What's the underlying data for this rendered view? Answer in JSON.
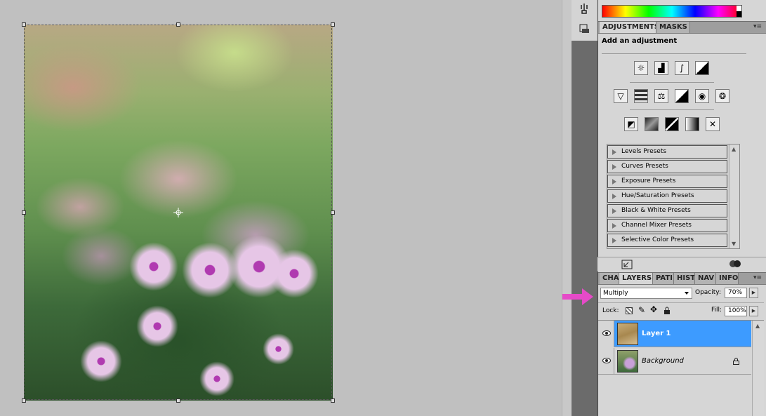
{
  "panels": {
    "adjustments": {
      "tabs": [
        "ADJUSTMENTS",
        "MASKS"
      ],
      "title": "Add an adjustment",
      "icon_rows": [
        [
          "brightness-contrast-icon",
          "levels-icon",
          "curves-icon",
          "exposure-icon"
        ],
        [
          "vibrance-icon",
          "hue-saturation-icon",
          "color-balance-icon",
          "black-white-icon",
          "photo-filter-icon",
          "channel-mixer-icon"
        ],
        [
          "invert-icon",
          "posterize-icon",
          "threshold-icon",
          "gradient-map-icon",
          "selective-color-icon"
        ]
      ],
      "presets": [
        "Levels Presets",
        "Curves Presets",
        "Exposure Presets",
        "Hue/Saturation Presets",
        "Black & White Presets",
        "Channel Mixer Presets",
        "Selective Color Presets"
      ]
    },
    "layers": {
      "tabs": [
        "CHA",
        "LAYERS",
        "PATI",
        "HIST",
        "NAV",
        "INFO"
      ],
      "blend_mode": "Multiply",
      "opacity_label": "Opacity:",
      "opacity_value": "70%",
      "lock_label": "Lock:",
      "fill_label": "Fill:",
      "fill_value": "100%",
      "layers": [
        {
          "name": "Layer 1",
          "selected": true,
          "locked": false
        },
        {
          "name": "Background",
          "selected": false,
          "locked": true
        }
      ]
    }
  },
  "colors": {
    "selection": "#3d9bff",
    "annotation_arrow": "#e64ac8"
  }
}
